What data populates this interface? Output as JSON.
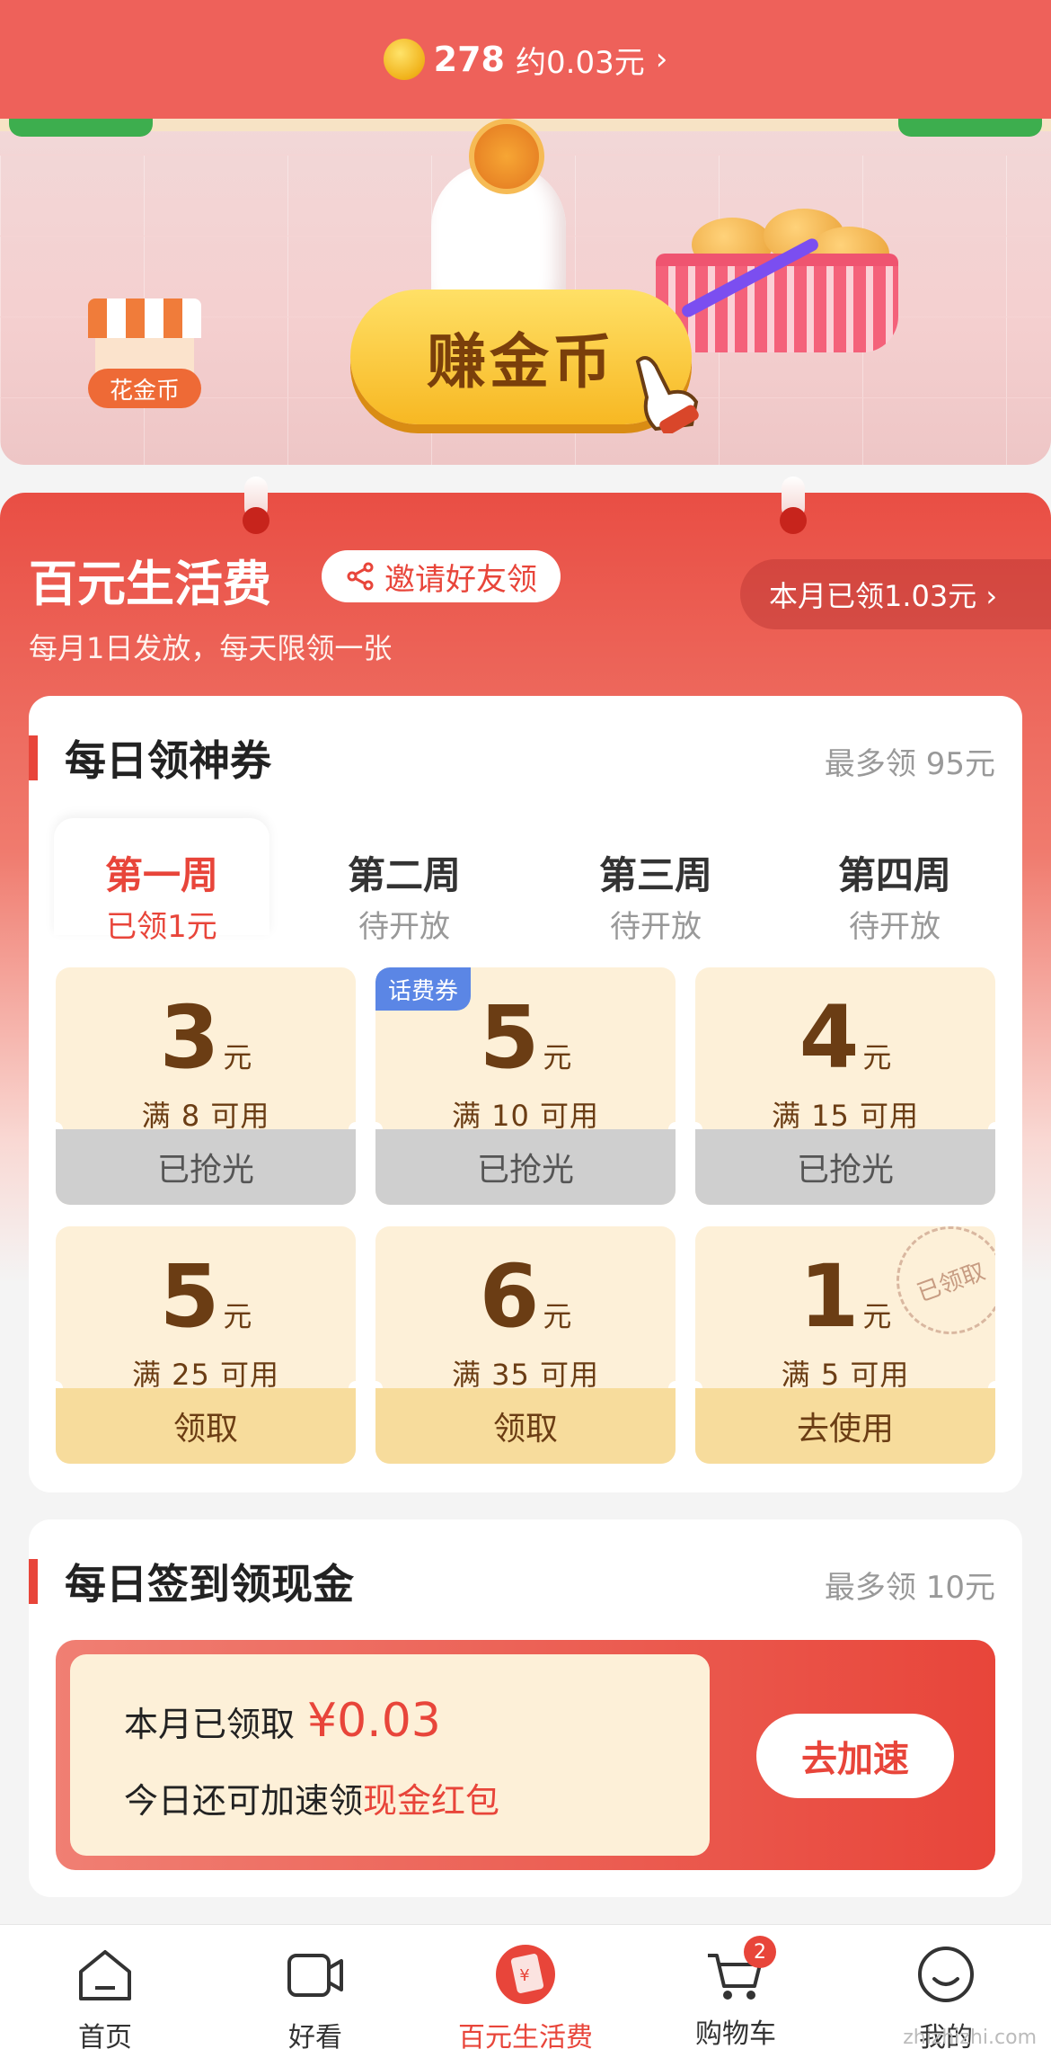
{
  "header": {
    "coin_count": "278",
    "coin_value": "约0.03元",
    "chevron": "›"
  },
  "banner": {
    "shop_label": "花金币",
    "earn_button": "赚金币"
  },
  "section": {
    "title": "百元生活费",
    "invite_label": "邀请好友领",
    "subtitle": "每月1日发放，每天限领一张",
    "month_received": "本月已领1.03元 ›"
  },
  "coupons_card": {
    "title": "每日领神券",
    "note": "最多领 95元",
    "weeks": [
      {
        "name": "第一周",
        "state": "已领1元"
      },
      {
        "name": "第二周",
        "state": "待开放"
      },
      {
        "name": "第三周",
        "state": "待开放"
      },
      {
        "name": "第四周",
        "state": "待开放"
      }
    ],
    "unit": "元",
    "coupons": [
      {
        "amount": "3",
        "condition": "满 8 可用",
        "action": "已抢光"
      },
      {
        "amount": "5",
        "condition": "满 10 可用",
        "action": "已抢光",
        "badge": "话费券"
      },
      {
        "amount": "4",
        "condition": "满 15 可用",
        "action": "已抢光"
      },
      {
        "amount": "5",
        "condition": "满 25 可用",
        "action": "领取"
      },
      {
        "amount": "6",
        "condition": "满 35 可用",
        "action": "领取"
      },
      {
        "amount": "1",
        "condition": "满 5 可用",
        "action": "去使用",
        "stamp": "已领取"
      }
    ]
  },
  "signin_card": {
    "title": "每日签到领现金",
    "note": "最多领 10元",
    "received_label": "本月已领取",
    "received_amount": "¥0.03",
    "today_prefix": "今日还可加速领",
    "today_highlight": "现金红包",
    "speed_button": "去加速"
  },
  "nav": {
    "items": [
      {
        "label": "首页",
        "icon": "home-icon"
      },
      {
        "label": "好看",
        "icon": "video-icon"
      },
      {
        "label": "百元生活费",
        "icon": "red-packet-icon"
      },
      {
        "label": "购物车",
        "icon": "cart-icon",
        "badge": "2"
      },
      {
        "label": "我的",
        "icon": "profile-icon"
      }
    ]
  },
  "watermark": "zhizhizhi.com",
  "colors": {
    "brand_red": "#e8453a",
    "top_bar": "#ee615a",
    "coupon_bg": "#fdf0d8",
    "badge_blue": "#5b86e5"
  }
}
